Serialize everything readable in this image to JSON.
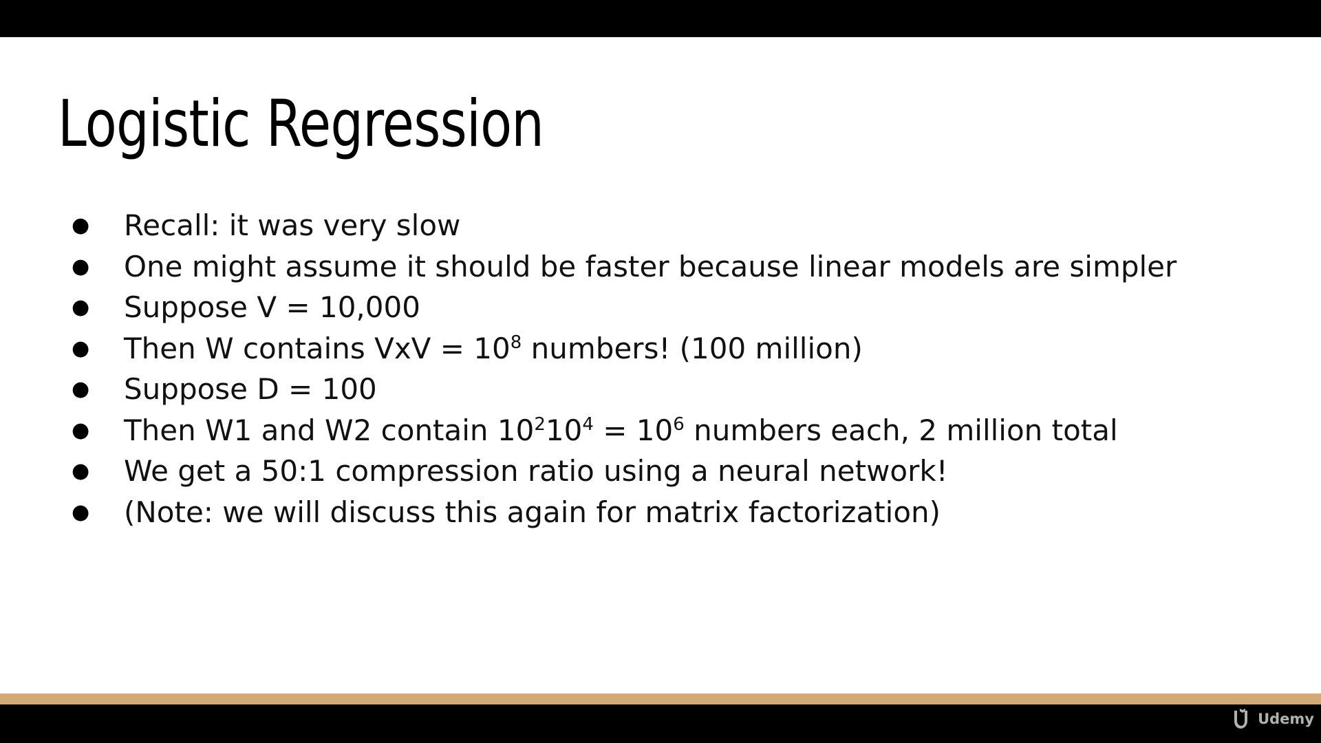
{
  "slide": {
    "title": "Logistic Regression",
    "bullets": [
      {
        "html": "Recall: it was very slow"
      },
      {
        "html": "One might assume it should be faster because linear models are simpler"
      },
      {
        "html": "Suppose V = 10,000"
      },
      {
        "html": "Then W contains VxV = 10<sup>8</sup> numbers! (100 million)"
      },
      {
        "html": "Suppose D = 100"
      },
      {
        "html": "Then W1 and W2 contain 10<sup>2</sup>10<sup>4</sup> = 10<sup>6</sup> numbers each, 2 million total"
      },
      {
        "html": "We get a 50:1 compression ratio using a neural network!"
      },
      {
        "html": "(Note: we will discuss this again for matrix factorization)"
      }
    ],
    "bullet_symbol": "●"
  },
  "accent_color": "#d4a978",
  "watermark": {
    "brand": "Udemy",
    "icon": "udemy-logo-icon"
  }
}
